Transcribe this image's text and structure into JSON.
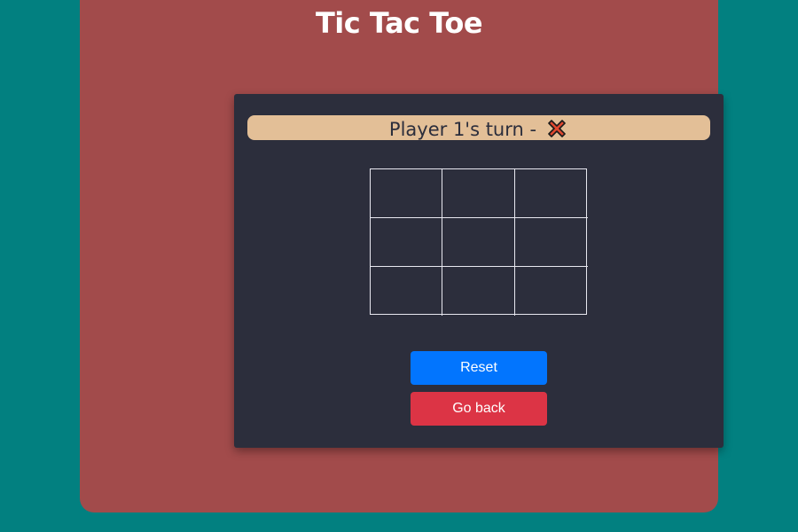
{
  "app": {
    "title": "Tic Tac Toe"
  },
  "status": {
    "turn_text": "Player 1's turn -",
    "current_symbol": "x-icon",
    "symbol_color": "#e0482f"
  },
  "board": {
    "cells": [
      "",
      "",
      "",
      "",
      "",
      "",
      "",
      "",
      ""
    ]
  },
  "buttons": {
    "reset_label": "Reset",
    "back_label": "Go back"
  },
  "colors": {
    "background": "#028080",
    "panel": "#a24b4b",
    "card": "#2c2e3c",
    "turn_bar": "#e3bf97",
    "reset": "#0275fe",
    "back": "#dc3445"
  }
}
